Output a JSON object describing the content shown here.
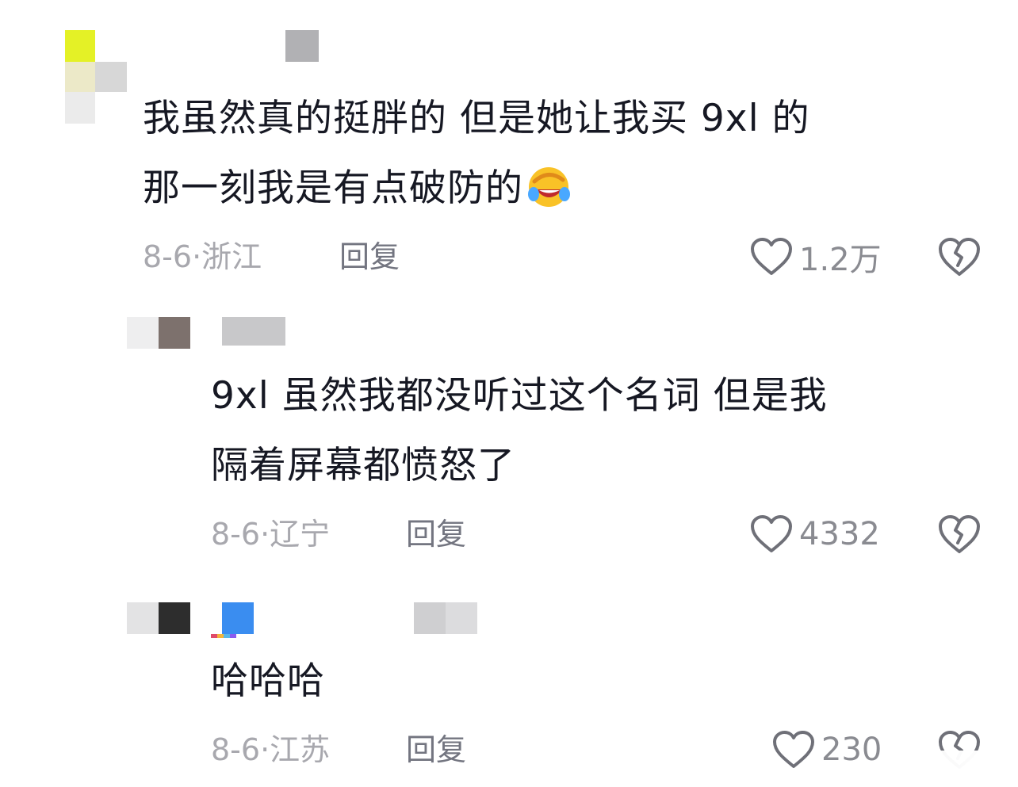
{
  "comments": [
    {
      "text_line1": "我虽然真的挺胖的 但是她让我买 9xl 的",
      "text_line2": "那一刻我是有点破防的",
      "emoji": "laughing-crying-emoji",
      "date": "8-6",
      "location": "浙江",
      "reply_label": "回复",
      "like_count": "1.2万"
    },
    {
      "text_line1": "9xl 虽然我都没听过这个名词 但是我",
      "text_line2": "隔着屏幕都愤怒了",
      "date": "8-6",
      "location": "辽宁",
      "reply_label": "回复",
      "like_count": "4332"
    },
    {
      "text_line1": "哈哈哈",
      "date": "8-6",
      "location": "江苏",
      "reply_label": "回复",
      "like_count": "230"
    }
  ],
  "meta_separator": "·",
  "icons": {
    "like": "heart-outline-icon",
    "dislike": "broken-heart-icon"
  },
  "colors": {
    "text": "#161823",
    "meta": "#a8a8ae",
    "reply": "#737580",
    "icon": "#6f7078"
  }
}
